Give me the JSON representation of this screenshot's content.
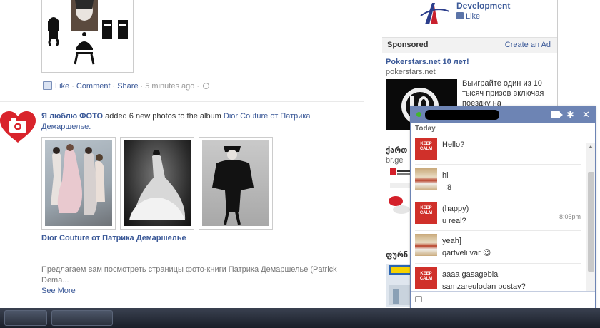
{
  "story1": {
    "actions": {
      "like": "Like",
      "comment": "Comment",
      "share": "Share",
      "time": "5 minutes ago"
    }
  },
  "story2": {
    "actor": "Я люблю ФОТО",
    "action": " added 6 new photos to the album ",
    "album_link": "Dior Couture от Патрика Демаршелье.",
    "album_title": "Dior Couture от Патрика Демаршелье",
    "description": "Предлагаем вам посмотреть страницы фото-книги Патрика Демаршелье (Patrick Dema...",
    "see_more": "See More"
  },
  "right": {
    "page_name": "Development",
    "like": "Like",
    "sponsored": "Sponsored",
    "create_ad": "Create an Ad",
    "ad1": {
      "title": "Pokerstars.net 10 лет!",
      "domain": "pokerstars.net",
      "text": "Выиграйте один из 10 тысяч призов включая поездку на"
    },
    "ad2": {
      "title": "ქართ",
      "domain": "br.ge"
    },
    "ad3": {
      "title": "ფურნ"
    }
  },
  "chat": {
    "today": "Today",
    "time": "8:05pm",
    "messages": [
      {
        "lines": [
          "Hello?"
        ]
      },
      {
        "lines": [
          "hi",
          ":8"
        ]
      },
      {
        "lines": [
          "(happy)",
          "u real?"
        ]
      },
      {
        "lines": [
          "yeah]",
          "qartveli var 😉"
        ]
      },
      {
        "lines": [
          "aaaa gasagebia",
          "samzareulodan postav?"
        ]
      }
    ],
    "keep_calm": "KEEP CALM"
  },
  "colors": {
    "fb_blue": "#3b5998",
    "chat_header": "#6d84b4"
  }
}
